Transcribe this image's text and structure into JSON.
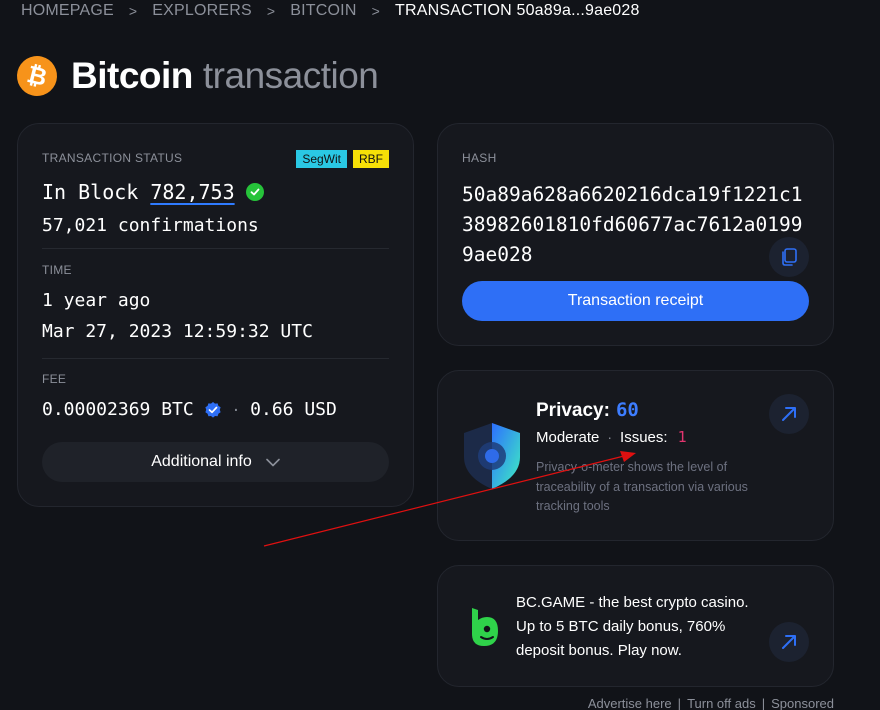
{
  "breadcrumb": {
    "items": [
      "HOMEPAGE",
      "EXPLORERS",
      "BITCOIN"
    ],
    "current": "TRANSACTION 50a89a...9ae028",
    "separator": ">"
  },
  "title": {
    "logo_symbol": "₿",
    "main": "Bitcoin",
    "sub": "transaction"
  },
  "status": {
    "label": "TRANSACTION STATUS",
    "badges": [
      "SegWit",
      "RBF"
    ],
    "block_prefix": "In Block",
    "block_number": "782,753",
    "confirmations": "57,021 confirmations"
  },
  "time": {
    "label": "TIME",
    "relative": "1 year ago",
    "absolute": "Mar 27, 2023 12:59:32 UTC"
  },
  "fee": {
    "label": "FEE",
    "btc": "0.00002369 BTC",
    "usd": "0.66 USD",
    "separator": "·"
  },
  "additional_info": {
    "label": "Additional info"
  },
  "hash": {
    "label": "HASH",
    "value": "50a89a628a6620216dca19f1221c138982601810fd60677ac7612a01999ae028",
    "receipt_label": "Transaction receipt"
  },
  "privacy": {
    "title": "Privacy:",
    "score": "60",
    "level": "Moderate",
    "issues_label": "Issues:",
    "issues_count": "1",
    "description": "Privacy-o-meter shows the level of traceability of a transaction via various tracking tools"
  },
  "ad": {
    "text": "BC.GAME - the best crypto casino. Up to 5 BTC daily bonus, 760% deposit bonus. Play now."
  },
  "ad_footer": {
    "advertise": "Advertise here",
    "turn_off": "Turn off ads",
    "sponsored": "Sponsored"
  },
  "colors": {
    "background": "#111318",
    "card": "#16181e",
    "accent_blue": "#2e6ff6",
    "bitcoin_orange": "#f7931a",
    "segwit": "#2ac8e4",
    "rbf": "#f6e007",
    "issues_pink": "#e2356f",
    "check_green": "#26c33a",
    "annotation_red": "#e01010"
  }
}
